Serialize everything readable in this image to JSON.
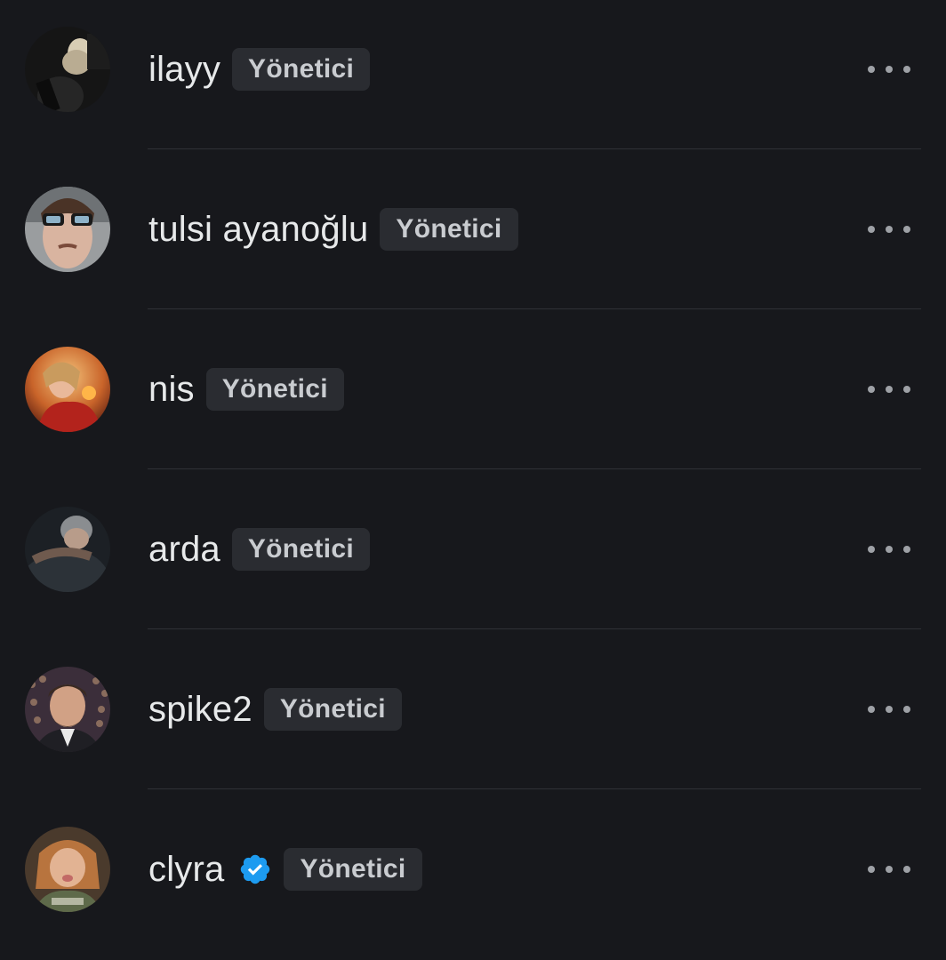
{
  "members": [
    {
      "name": "ilayy",
      "role": "Yönetici",
      "verified": false,
      "avatar_icon": "user-photo-icon"
    },
    {
      "name": "tulsi ayanoğlu",
      "role": "Yönetici",
      "verified": false,
      "avatar_icon": "user-photo-icon"
    },
    {
      "name": "nis",
      "role": "Yönetici",
      "verified": false,
      "avatar_icon": "user-photo-icon"
    },
    {
      "name": "arda",
      "role": "Yönetici",
      "verified": false,
      "avatar_icon": "user-photo-icon"
    },
    {
      "name": "spike2",
      "role": "Yönetici",
      "verified": false,
      "avatar_icon": "user-photo-icon"
    },
    {
      "name": "clyra",
      "role": "Yönetici",
      "verified": true,
      "avatar_icon": "user-photo-icon"
    }
  ],
  "icons": {
    "more": "more-horizontal-icon",
    "verified": "verified-badge-icon"
  },
  "colors": {
    "background": "#17181c",
    "badge_bg": "#2a2c31",
    "badge_text": "#c9ccd0",
    "name_text": "#e7e9ea",
    "verified_blue": "#1d9bf0",
    "divider": "#2f3136"
  }
}
